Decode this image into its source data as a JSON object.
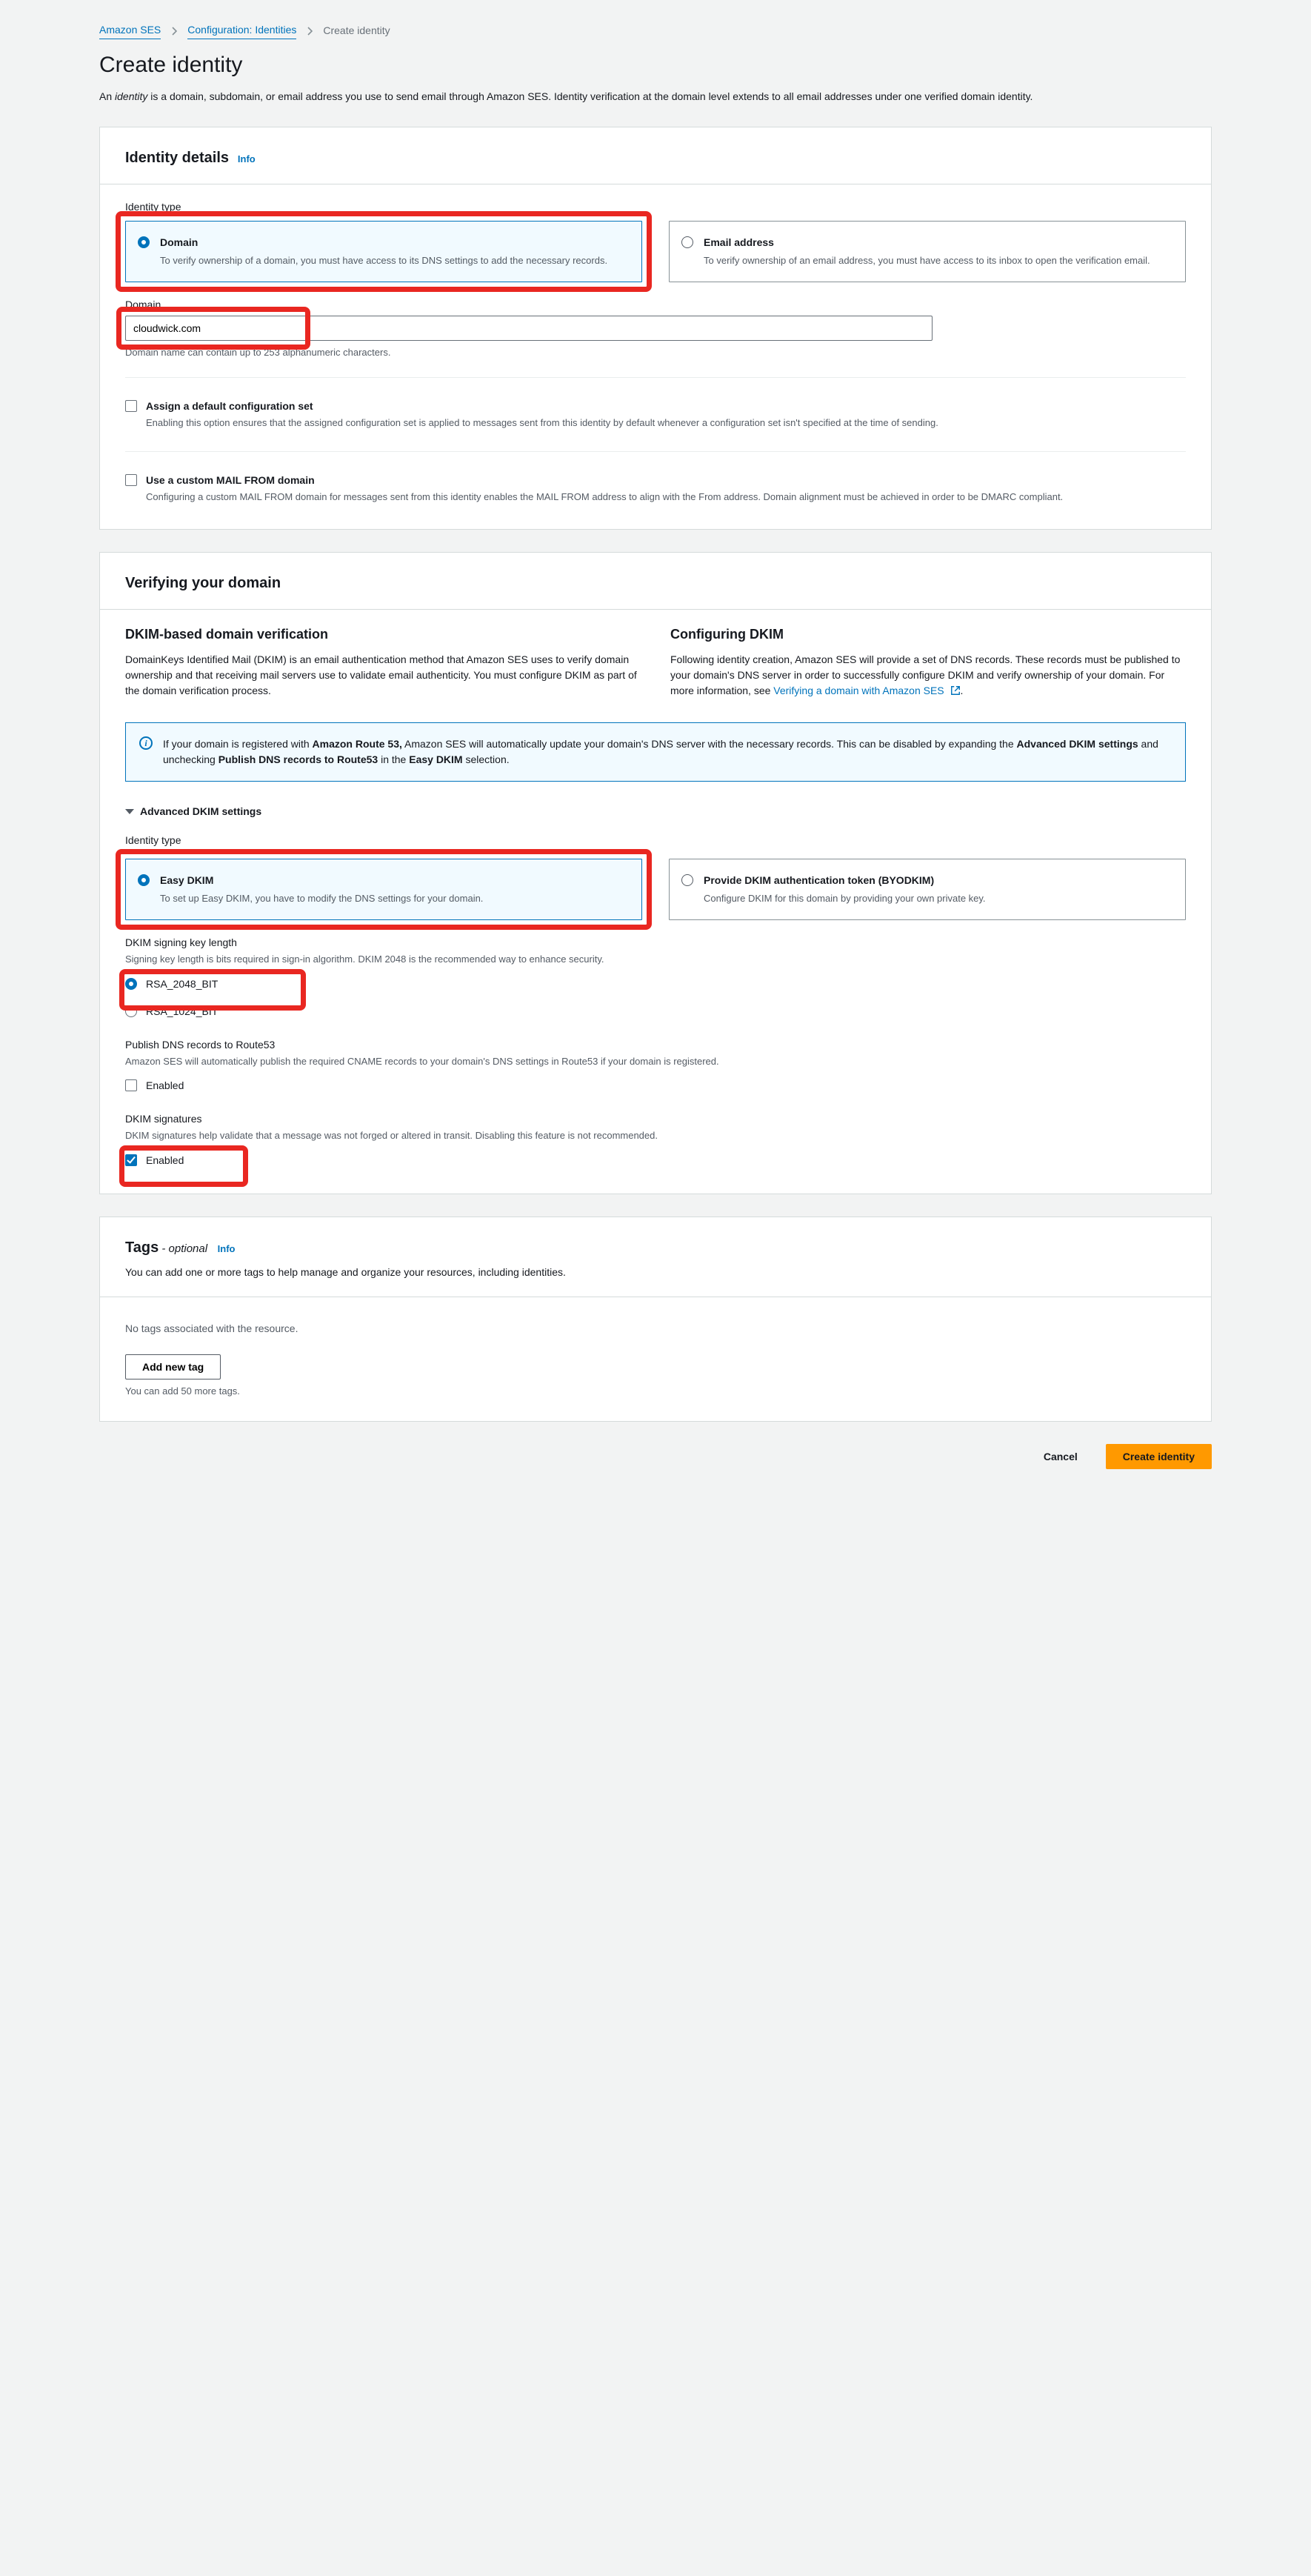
{
  "breadcrumb": {
    "root": "Amazon SES",
    "mid": "Configuration: Identities",
    "current": "Create identity"
  },
  "page": {
    "title": "Create identity",
    "desc_pre": "An ",
    "desc_em": "identity",
    "desc_post": " is a domain, subdomain, or email address you use to send email through Amazon SES. Identity verification at the domain level extends to all email addresses under one verified domain identity."
  },
  "identity": {
    "panel_title": "Identity details",
    "info": "Info",
    "type_label": "Identity type",
    "tile_domain": {
      "title": "Domain",
      "desc": "To verify ownership of a domain, you must have access to its DNS settings to add the necessary records."
    },
    "tile_email": {
      "title": "Email address",
      "desc": "To verify ownership of an email address, you must have access to its inbox to open the verification email."
    },
    "domain_label": "Domain",
    "domain_value": "cloudwick.com",
    "domain_help": "Domain name can contain up to 253 alphanumeric characters.",
    "cfgset": {
      "title": "Assign a default configuration set",
      "desc": "Enabling this option ensures that the assigned configuration set is applied to messages sent from this identity by default whenever a configuration set isn't specified at the time of sending."
    },
    "mailfrom": {
      "title": "Use a custom MAIL FROM domain",
      "desc": "Configuring a custom MAIL FROM domain for messages sent from this identity enables the MAIL FROM address to align with the From address. Domain alignment must be achieved in order to be DMARC compliant."
    }
  },
  "verify": {
    "panel_title": "Verifying your domain",
    "dkim_h": "DKIM-based domain verification",
    "dkim_p": "DomainKeys Identified Mail (DKIM) is an email authentication method that Amazon SES uses to verify domain ownership and that receiving mail servers use to validate email authenticity. You must configure DKIM as part of the domain verification process.",
    "cfg_h": "Configuring DKIM",
    "cfg_p_pre": "Following identity creation, Amazon SES will provide a set of DNS records. These records must be published to your domain's DNS server in order to successfully configure DKIM and verify ownership of your domain. For more information, see ",
    "cfg_link": "Verifying a domain with Amazon SES",
    "alert_pre": "If your domain is registered with ",
    "alert_b1": "Amazon Route 53,",
    "alert_mid1": " Amazon SES will automatically update your domain's DNS server with the necessary records. This can be disabled by expanding the ",
    "alert_b2": "Advanced DKIM settings",
    "alert_mid2": " and unchecking ",
    "alert_b3": "Publish DNS records to Route53",
    "alert_mid3": " in the ",
    "alert_b4": "Easy DKIM",
    "alert_end": " selection.",
    "adv_title": "Advanced DKIM settings",
    "adv_type_label": "Identity type",
    "easy": {
      "title": "Easy DKIM",
      "desc": "To set up Easy DKIM, you have to modify the DNS settings for your domain."
    },
    "byo": {
      "title": "Provide DKIM authentication token (BYODKIM)",
      "desc": "Configure DKIM for this domain by providing your own private key."
    },
    "keylen_label": "DKIM signing key length",
    "keylen_help": "Signing key length is bits required in sign-in algorithm. DKIM 2048 is the recommended way to enhance security.",
    "key2048": "RSA_2048_BIT",
    "key1024": "RSA_1024_BIT",
    "pub_label": "Publish DNS records to Route53",
    "pub_help": "Amazon SES will automatically publish the required CNAME records to your domain's DNS settings in Route53 if your domain is registered.",
    "pub_enabled": "Enabled",
    "sig_label": "DKIM signatures",
    "sig_help": "DKIM signatures help validate that a message was not forged or altered in transit. Disabling this feature is not recommended.",
    "sig_enabled": "Enabled"
  },
  "tags": {
    "title": "Tags",
    "optional": " - optional",
    "info": "Info",
    "desc": "You can add one or more tags to help manage and organize your resources, including identities.",
    "empty": "No tags associated with the resource.",
    "add_btn": "Add new tag",
    "limit": "You can add 50 more tags."
  },
  "footer": {
    "cancel": "Cancel",
    "create": "Create identity"
  }
}
